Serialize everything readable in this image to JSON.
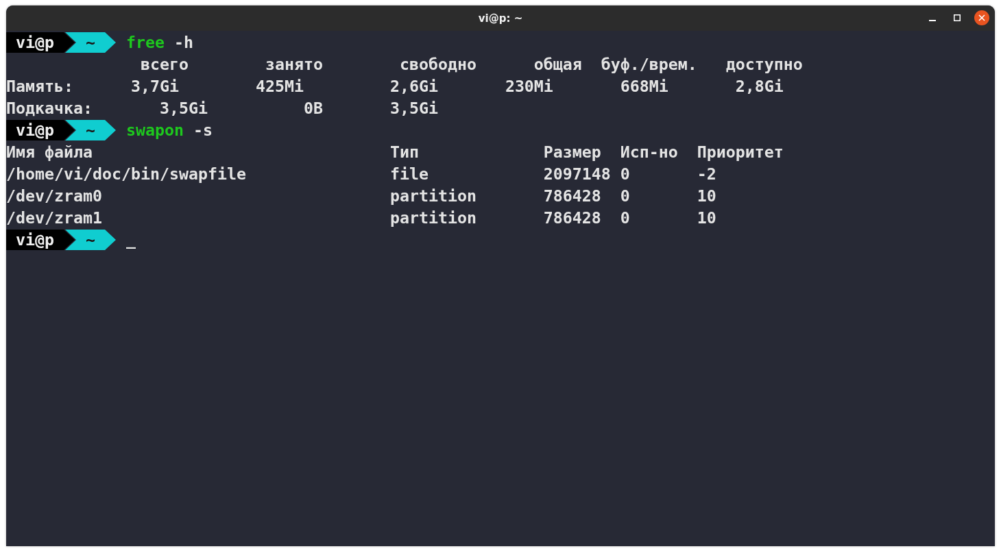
{
  "window": {
    "title": "vi@p: ~"
  },
  "terminal": {
    "blocks": [
      {
        "kind": "prompt",
        "user": "vi@p",
        "dir": "~",
        "command": "free",
        "args": "-h"
      },
      {
        "kind": "output",
        "text": "              всего        занято        свободно      общая  буф./врем.   доступно"
      },
      {
        "kind": "output",
        "text": "Память:      3,7Gi        425Mi         2,6Gi       230Mi       668Mi       2,8Gi"
      },
      {
        "kind": "output",
        "text": "Подкачка:       3,5Gi          0B       3,5Gi"
      },
      {
        "kind": "prompt",
        "user": "vi@p",
        "dir": "~",
        "command": "swapon",
        "args": "-s"
      },
      {
        "kind": "output",
        "text": "Имя файла                               Тип             Размер  Исп-но  Приоритет"
      },
      {
        "kind": "output",
        "text": "/home/vi/doc/bin/swapfile               file            2097148 0       -2"
      },
      {
        "kind": "output",
        "text": "/dev/zram0                              partition       786428  0       10"
      },
      {
        "kind": "output",
        "text": "/dev/zram1                              partition       786428  0       10"
      },
      {
        "kind": "prompt",
        "user": "vi@p",
        "dir": "~",
        "cursor": "_"
      }
    ]
  }
}
